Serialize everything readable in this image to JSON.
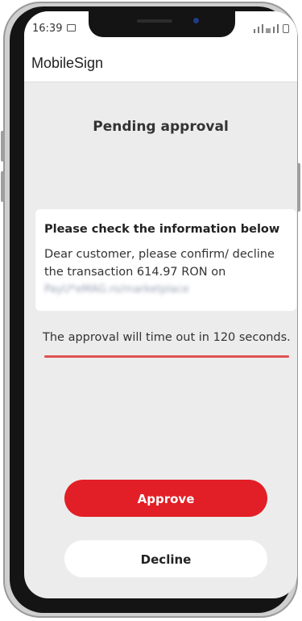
{
  "status_bar": {
    "time": "16:39",
    "icons": [
      "image-icon",
      "signal-icon",
      "volte-icon",
      "battery-icon"
    ]
  },
  "app_bar": {
    "title": "MobileSign"
  },
  "main": {
    "title": "Pending approval",
    "card": {
      "heading": "Please check the information below",
      "body": "Dear customer, please confirm/ decline the transaction 614.97 RON on",
      "merchant_blurred": "PayU*eMAG.ro/marketplace"
    },
    "timeout_text": "The approval will time out in 120 seconds.",
    "timeout_progress": 1.0
  },
  "actions": {
    "approve_label": "Approve",
    "decline_label": "Decline"
  },
  "colors": {
    "accent": "#e21f26",
    "screen_bg": "#ececec",
    "progress": "#e05252"
  }
}
